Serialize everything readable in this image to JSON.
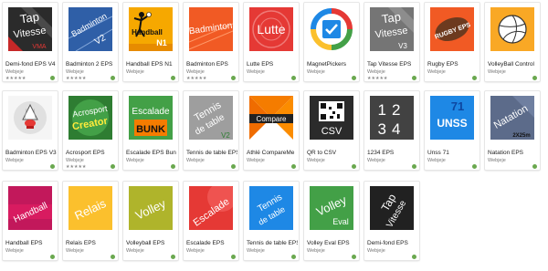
{
  "apps": [
    {
      "title": "Demi-fond EPS V4",
      "developer": "Webjeje",
      "stars": "★★★★★",
      "icon": "tap-vitesse-icon",
      "icon_text": [
        "Tap",
        "Vitesse",
        "VMA"
      ]
    },
    {
      "title": "Badminton 2 EPS",
      "developer": "Webjeje",
      "stars": "★★★★★",
      "icon": "badminton-v2-icon",
      "icon_text": [
        "Badminton",
        "V2"
      ]
    },
    {
      "title": "Handball EPS N1",
      "developer": "Webjeje",
      "stars": "",
      "icon": "handball-n1-icon",
      "icon_text": [
        "Handball",
        "N1"
      ]
    },
    {
      "title": "Badminton EPS",
      "developer": "Webjeje",
      "stars": "★★★★★",
      "icon": "badminton-icon",
      "icon_text": [
        "Badminton"
      ]
    },
    {
      "title": "Lutte EPS",
      "developer": "Webjeje",
      "stars": "",
      "icon": "lutte-icon",
      "icon_text": [
        "Lutte"
      ]
    },
    {
      "title": "MagnetPickers",
      "developer": "Webjeje",
      "stars": "",
      "icon": "magnetpickers-icon",
      "icon_text": []
    },
    {
      "title": "Tap Vitesse EPS",
      "developer": "Webjeje",
      "stars": "★★★★★",
      "icon": "tap-vitesse-v3-icon",
      "icon_text": [
        "Tap",
        "Vitesse",
        "V3"
      ]
    },
    {
      "title": "Rugby EPS",
      "developer": "Webjeje",
      "stars": "",
      "icon": "rugby-icon",
      "icon_text": [
        "RUGBY EPS"
      ]
    },
    {
      "title": "VolleyBall Control",
      "developer": "Webjeje",
      "stars": "",
      "icon": "volleyball-icon",
      "icon_text": []
    },
    {
      "title": "Badminton EPS V3",
      "developer": "Webjeje",
      "stars": "",
      "icon": "badminton-v3-icon",
      "icon_text": []
    },
    {
      "title": "Acrosport EPS",
      "developer": "Webjeje",
      "stars": "★★★★★",
      "icon": "acrosport-icon",
      "icon_text": [
        "Acrosport",
        "Creator"
      ]
    },
    {
      "title": "Escalade EPS Bun",
      "developer": "Webjeje",
      "stars": "",
      "icon": "escalade-bunk-icon",
      "icon_text": [
        "Escalade",
        "BUNK"
      ]
    },
    {
      "title": "Tennis de table EPS",
      "developer": "Webjeje",
      "stars": "",
      "icon": "tennis-de-table-v2-icon",
      "icon_text": [
        "Tennis",
        "de table",
        "V2"
      ]
    },
    {
      "title": "Athlé CompareMe",
      "developer": "Webjeje",
      "stars": "",
      "icon": "compare-icon",
      "icon_text": [
        "Compare"
      ]
    },
    {
      "title": "QR to CSV",
      "developer": "Webjeje",
      "stars": "",
      "icon": "qr-csv-icon",
      "icon_text": [
        "CSV"
      ]
    },
    {
      "title": "1234 EPS",
      "developer": "Webjeje",
      "stars": "",
      "icon": "1234-icon",
      "icon_text": [
        "12",
        "34"
      ]
    },
    {
      "title": "Unss 71",
      "developer": "Webjeje",
      "stars": "",
      "icon": "unss-icon",
      "icon_text": [
        "71",
        "UNSS"
      ]
    },
    {
      "title": "Natation EPS",
      "developer": "Webjeje",
      "stars": "",
      "icon": "natation-icon",
      "icon_text": [
        "Natation",
        "2X25m"
      ]
    },
    {
      "title": "Handball EPS",
      "developer": "Webjeje",
      "stars": "",
      "icon": "handball-icon",
      "icon_text": [
        "Handball"
      ]
    },
    {
      "title": "Relais EPS",
      "developer": "Webjeje",
      "stars": "",
      "icon": "relais-icon",
      "icon_text": [
        "Relais"
      ]
    },
    {
      "title": "Volleyball EPS",
      "developer": "Webjeje",
      "stars": "",
      "icon": "volley-icon",
      "icon_text": [
        "Volley"
      ]
    },
    {
      "title": "Escalade EPS",
      "developer": "Webjeje",
      "stars": "",
      "icon": "escalade-icon",
      "icon_text": [
        "Escalade"
      ]
    },
    {
      "title": "Tennis de table EPS",
      "developer": "Webjeje",
      "stars": "",
      "icon": "tennis-de-table-icon",
      "icon_text": [
        "Tennis",
        "de table"
      ]
    },
    {
      "title": "Volley Eval EPS",
      "developer": "Webjeje",
      "stars": "",
      "icon": "volley-eval-icon",
      "icon_text": [
        "Volley",
        "Eval"
      ]
    },
    {
      "title": "Demi-fond EPS",
      "developer": "Webjeje",
      "stars": "",
      "icon": "tap-vitesse-dark-icon",
      "icon_text": [
        "Tap",
        "Vitesse"
      ]
    }
  ]
}
